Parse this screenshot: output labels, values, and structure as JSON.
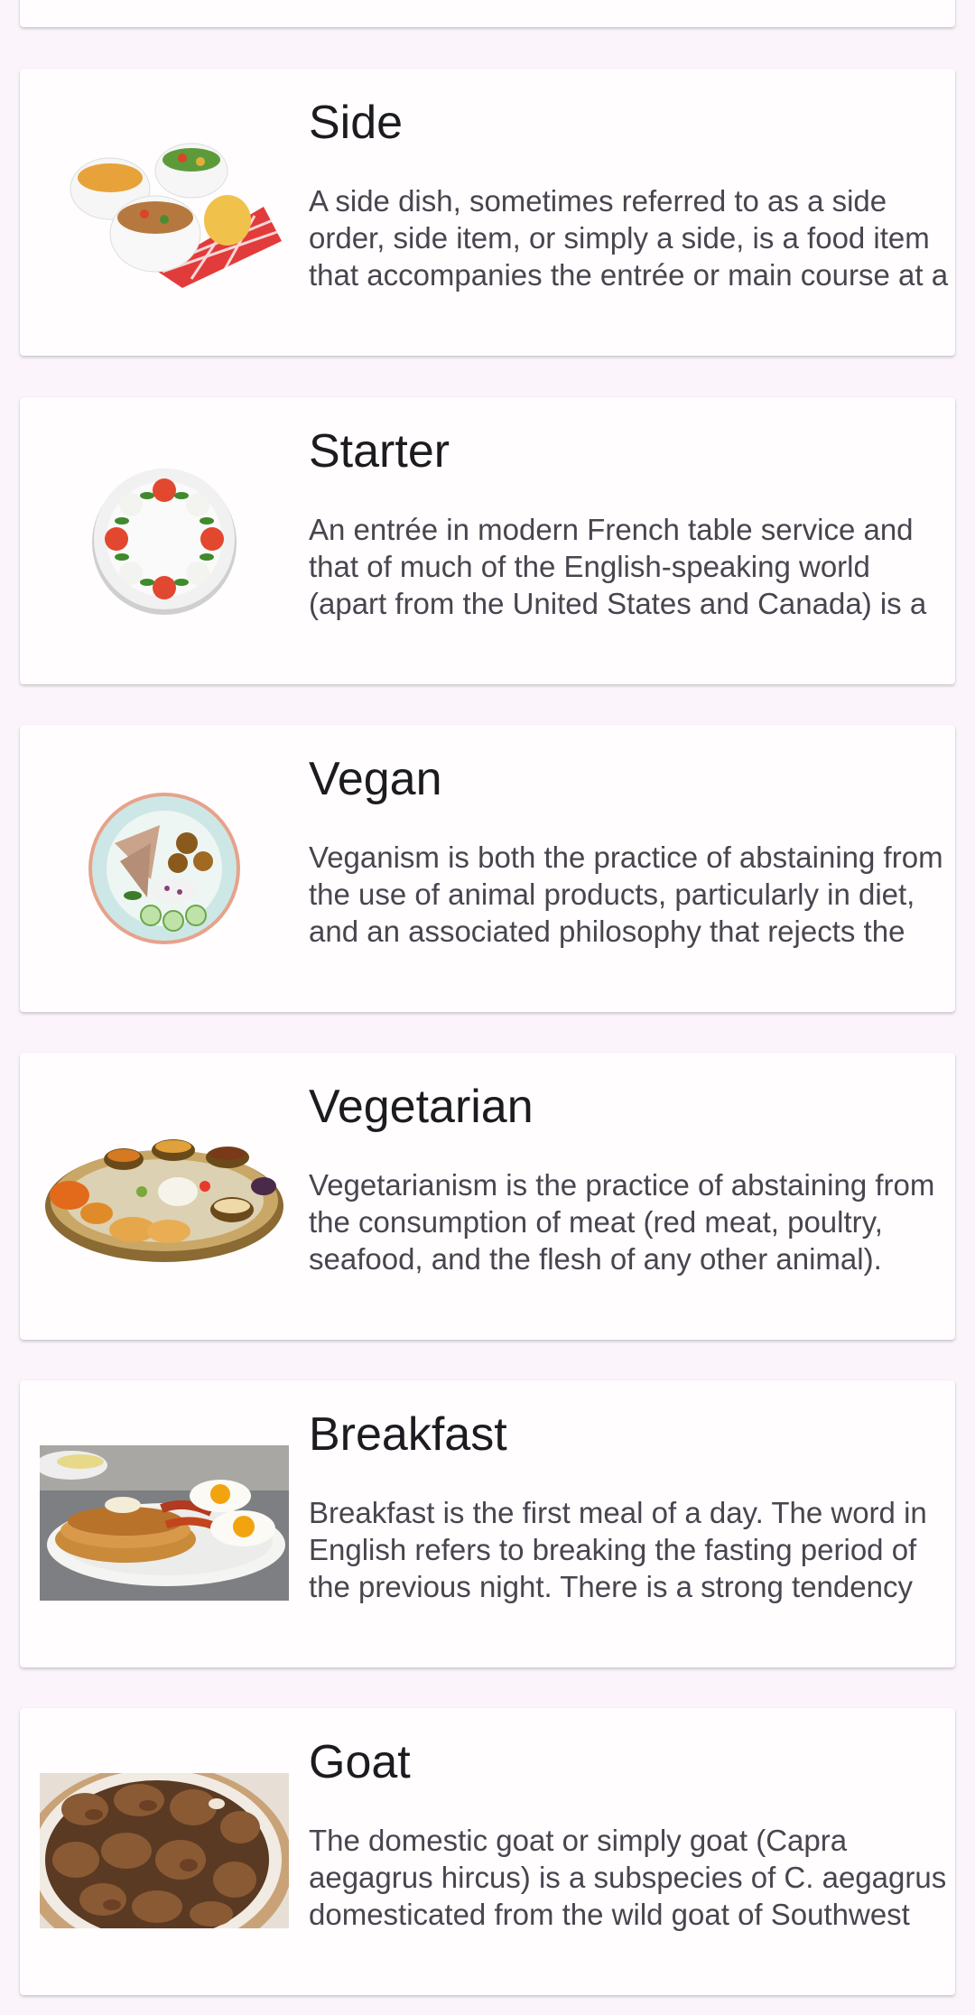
{
  "categories": [
    {
      "title": "Side",
      "description": "A side dish, sometimes referred to as a side order, side item, or simply a side, is a food item that accompanies the entrée or main course at a meal.",
      "image": "side-dishes-image"
    },
    {
      "title": "Starter",
      "description": "An entrée in modern French table service and that of much of the English-speaking world (apart from the United States and Canada) is a dish served before the main course.",
      "image": "caprese-starter-image"
    },
    {
      "title": "Vegan",
      "description": "Veganism is both the practice of abstaining from the use of animal products, particularly in diet, and an associated philosophy that rejects the commodity status of animals.",
      "image": "vegan-bowl-image"
    },
    {
      "title": "Vegetarian",
      "description": "Vegetarianism is the practice of abstaining from the consumption of meat (red meat, poultry, seafood, and the flesh of any other animal).",
      "image": "thali-platter-image"
    },
    {
      "title": "Breakfast",
      "description": "Breakfast is the first meal of a day. The word in English refers to breaking the fasting period of the previous night. There is a strong tendency for one or more typical foods.",
      "image": "pancakes-eggs-image"
    },
    {
      "title": "Goat",
      "description": "The domestic goat or simply goat (Capra aegagrus hircus) is a subspecies of C. aegagrus domesticated from the wild goat of Southwest Asia and Eastern Europe.",
      "image": "goat-meat-image"
    }
  ]
}
